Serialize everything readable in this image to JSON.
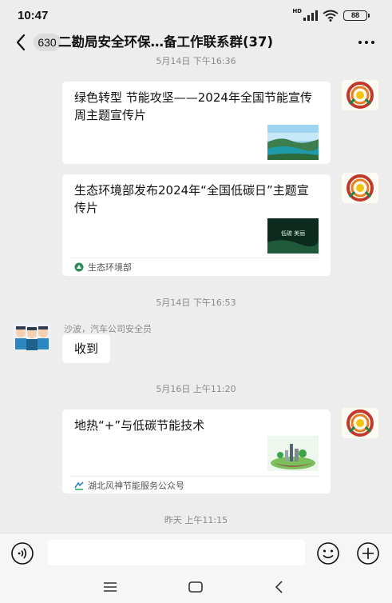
{
  "status_bar": {
    "time": "10:47",
    "network": "HD",
    "battery": "88"
  },
  "header": {
    "unread_count": "630",
    "title": "二勘局安全环保…备工作联系群(37)"
  },
  "messages": [
    {
      "type": "timestamp",
      "text": "5月14日 下午16:36"
    },
    {
      "type": "card",
      "sender": "self",
      "title": "绿色转型 节能攻坚——2024年全国节能宣传周主题宣传片",
      "source": ""
    },
    {
      "type": "card",
      "sender": "self",
      "title": "生态环境部发布2024年“全国低碳日”主题宣传片",
      "thumb_text": "低碳 美丽",
      "source": "生态环境部"
    },
    {
      "type": "timestamp",
      "text": "5月14日 下午16:53"
    },
    {
      "type": "text",
      "sender": "other",
      "sender_name": "沙波，汽车公司安全员",
      "text": "收到"
    },
    {
      "type": "timestamp",
      "text": "5月16日 上午11:20"
    },
    {
      "type": "card",
      "sender": "self",
      "title": "地热“+”与低碳节能技术",
      "source": "湖北风神节能服务公众号"
    },
    {
      "type": "timestamp",
      "text": "昨天 上午11:15"
    }
  ],
  "input_bar": {
    "placeholder": ""
  },
  "colors": {
    "background": "#ededed",
    "bubble": "#ffffff",
    "timestamp": "#8a8a8a"
  }
}
